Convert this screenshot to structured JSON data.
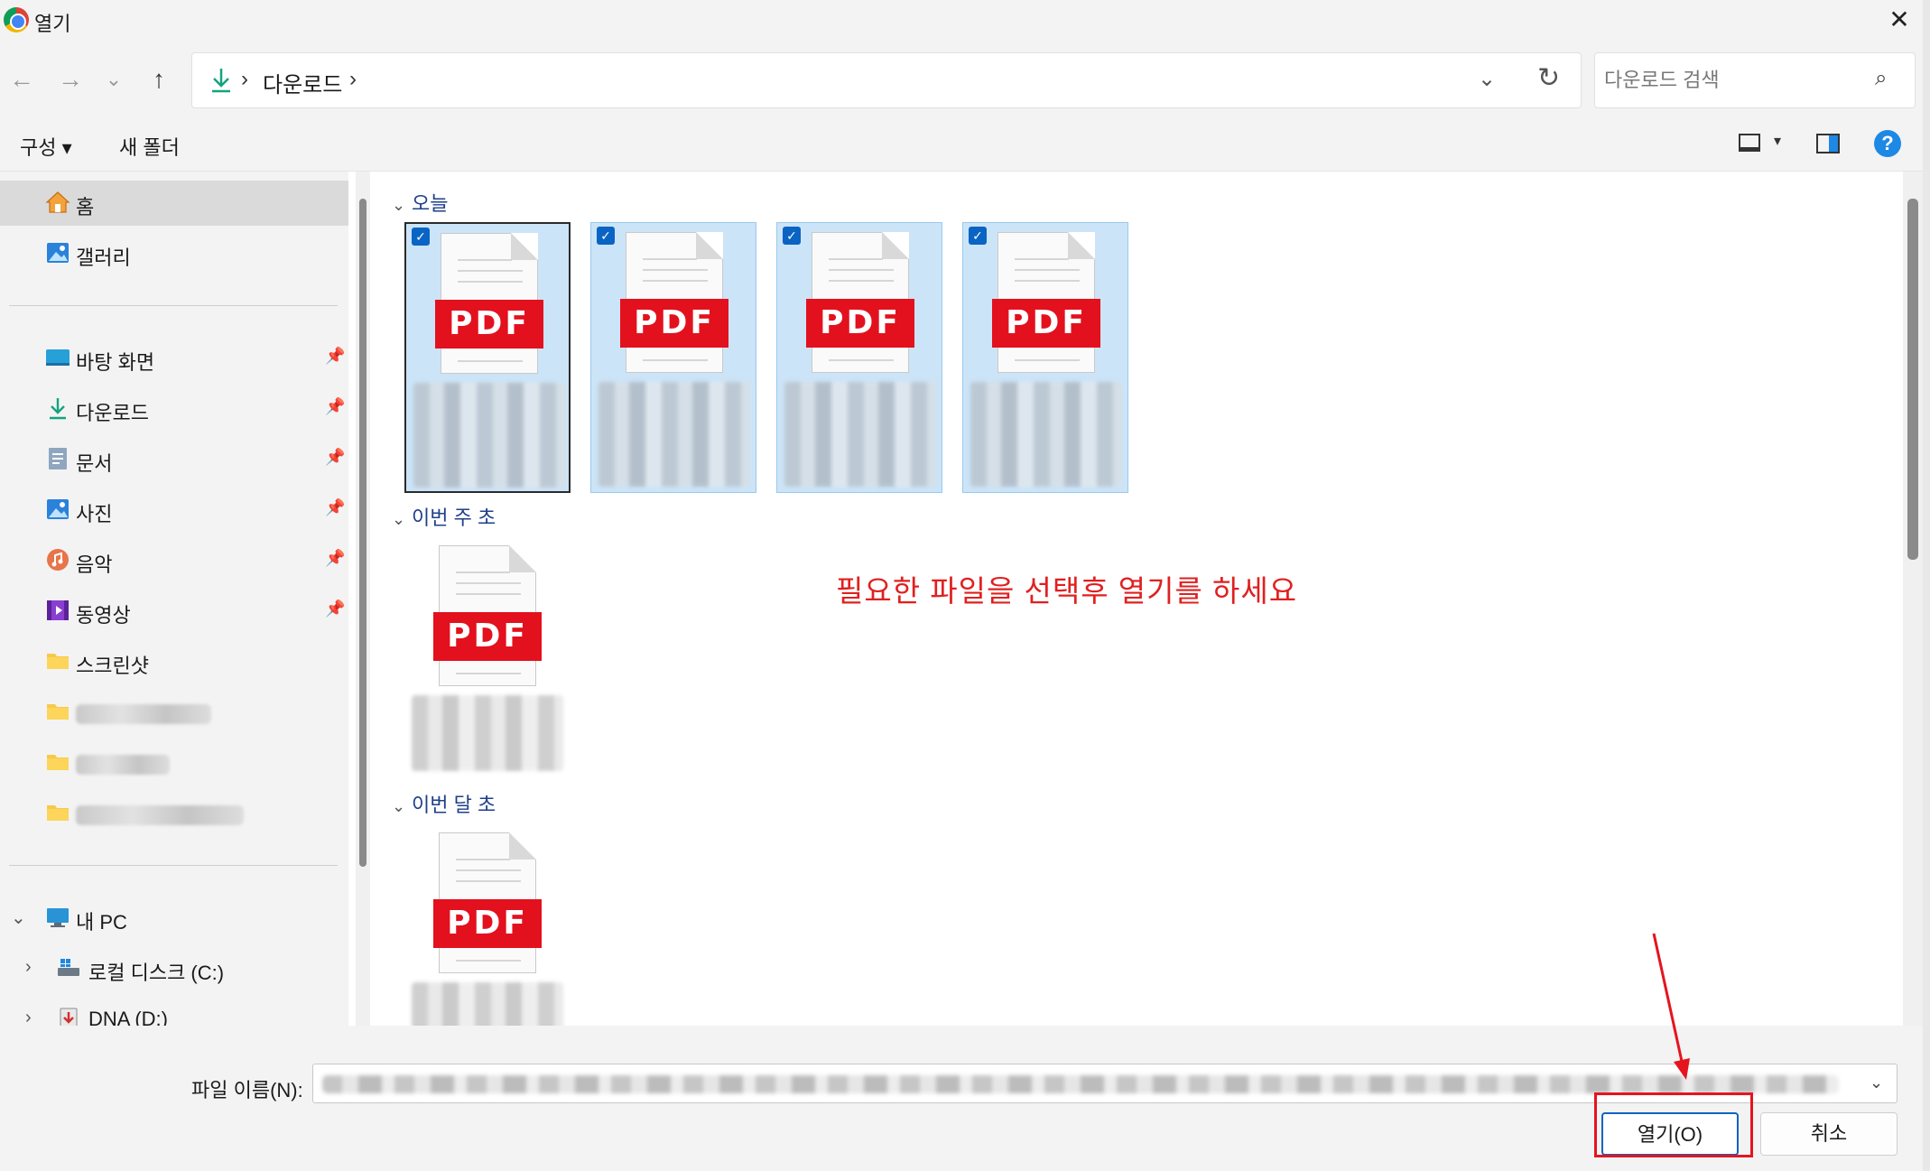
{
  "window": {
    "title": "열기",
    "close_glyph": "✕"
  },
  "nav": {
    "back_glyph": "←",
    "forward_glyph": "→",
    "recent_glyph": "⌄",
    "up_glyph": "↑"
  },
  "address": {
    "crumb_sep": "›",
    "path_label": "다운로드",
    "dropdown_glyph": "⌄",
    "refresh_glyph": "↻"
  },
  "search": {
    "placeholder": "다운로드 검색",
    "icon_glyph": "⌕"
  },
  "commands": {
    "organize_label": "구성 ▾",
    "new_folder_label": "새 폴더",
    "view_caret": "▾",
    "help_glyph": "?"
  },
  "sidebar": {
    "quick": [
      {
        "label": "홈"
      },
      {
        "label": "갤러리"
      }
    ],
    "pinned": [
      {
        "label": "바탕 화면"
      },
      {
        "label": "다운로드"
      },
      {
        "label": "문서"
      },
      {
        "label": "사진"
      },
      {
        "label": "음악"
      },
      {
        "label": "동영상"
      },
      {
        "label": "스크린샷"
      }
    ],
    "pin_glyph": "📌",
    "this_pc": {
      "label": "내 PC",
      "expanded_glyph": "⌄",
      "collapsed_glyph": "›",
      "drives": [
        {
          "label": "로컬 디스크 (C:)"
        },
        {
          "label": "DNA (D:)"
        }
      ]
    }
  },
  "groups": [
    {
      "header": "오늘",
      "caret": "⌄"
    },
    {
      "header": "이번 주 초",
      "caret": "⌄"
    },
    {
      "header": "이번 달 초",
      "caret": "⌄"
    }
  ],
  "file_icon_badge": "PDF",
  "check_glyph": "✓",
  "instruction": "필요한 파일을 선택후 열기를 하세요",
  "filename": {
    "label": "파일 이름(N):",
    "dropdown_glyph": "⌄"
  },
  "buttons": {
    "open": "열기(O)",
    "cancel": "취소"
  },
  "colors": {
    "accent": "#0a64c4",
    "annotation_red": "#e5141e",
    "pdf_red": "#e3111e",
    "selection": "#cce4f7"
  }
}
